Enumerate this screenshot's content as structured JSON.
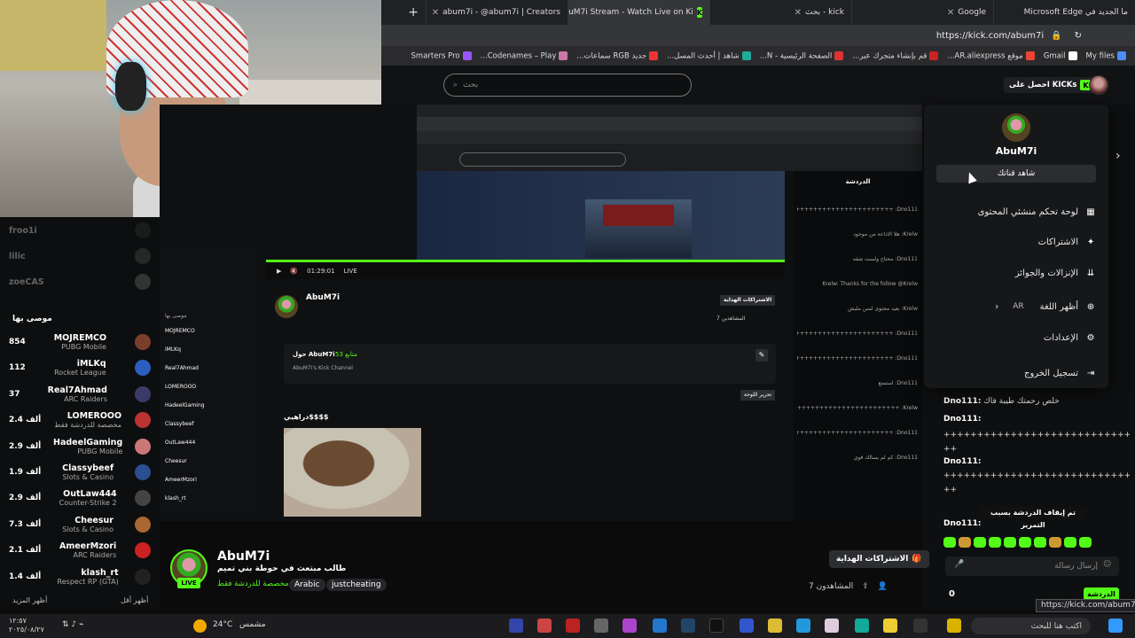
{
  "browser": {
    "tabs": [
      {
        "label": "ما الجديد في Microsoft Edge",
        "active": false
      },
      {
        "label": "Google",
        "active": false
      },
      {
        "label": "kick - بحث",
        "active": false
      },
      {
        "label": "AbuM7i Stream - Watch Live on Ki",
        "active": true
      },
      {
        "label": "abum7i - @abum7i | Creators",
        "active": false
      }
    ],
    "new_tab": "+",
    "url": "https://kick.com/abum7i",
    "bookmarks": [
      "My files",
      "Gmail",
      "موقع AR.aliexpress...",
      "قم بإنشاء متجرك عبر...",
      "الصفحة الرئيسية - N...",
      "شاهد | أحدث المسل...",
      "جديد RGB سماعات...",
      "Codenames – Play...",
      "Smarters Pro"
    ]
  },
  "kick": {
    "search_placeholder": "بحث",
    "get_kicks": "احصل على KICKs"
  },
  "menu": {
    "username": "AbuM7i",
    "channel_button": "شاهد قناتك",
    "items": [
      {
        "label": "لوحة تحكم منشئي المحتوى",
        "icon": "dashboard-icon"
      },
      {
        "label": "الاشتراكات",
        "icon": "sparkle-icon"
      },
      {
        "label": "الإنزالات والجوائز",
        "icon": "drops-icon"
      },
      {
        "label": "أظهر اللغة",
        "icon": "globe-icon",
        "value": "AR"
      },
      {
        "label": "الإعدادات",
        "icon": "gear-icon"
      },
      {
        "label": "تسجيل الخروج",
        "icon": "logout-icon"
      }
    ]
  },
  "sidebar": {
    "dimmed": [
      {
        "name": "froo1i"
      },
      {
        "name": "lilic"
      },
      {
        "name": "zoeCAS"
      }
    ],
    "section_title": "موصى بها",
    "recommended": [
      {
        "name": "MOJREMCO",
        "category": "PUBG Mobile",
        "count": "854",
        "color": "#7a3f2a"
      },
      {
        "name": "iMLKq",
        "category": "Rocket League",
        "count": "112",
        "color": "#2a5fbf"
      },
      {
        "name": "Real7Ahmad",
        "category": "ARC Raiders",
        "count": "37",
        "color": "#3a3a6a"
      },
      {
        "name": "LOMEROOO",
        "category": "مخصصة للدردشة فقط",
        "count": "2.4 ألف",
        "color": "#b33"
      },
      {
        "name": "HadeelGaming",
        "category": "PUBG Mobile",
        "count": "2.9 ألف",
        "color": "#c77"
      },
      {
        "name": "Classybeef",
        "category": "Slots & Casino",
        "count": "1.9 ألف",
        "color": "#2a4e8f"
      },
      {
        "name": "OutLaw444",
        "category": "Counter-Strike 2",
        "count": "2.9 ألف",
        "color": "#444"
      },
      {
        "name": "Cheesur",
        "category": "Slots & Casino",
        "count": "7.3 ألف",
        "color": "#a63"
      },
      {
        "name": "AmeerMzori",
        "category": "ARC Raiders",
        "count": "2.1 ألف",
        "color": "#c22"
      },
      {
        "name": "klash_rt",
        "category": "Respect RP (GTA)",
        "count": "1.4 ألف",
        "color": "#222"
      }
    ],
    "show_more": "أظهر المزيد",
    "show_less": "أظهر أقل"
  },
  "nested": {
    "time": "01:29:01",
    "live": "LIVE",
    "streamer": "AbuM7i",
    "about": "حول AbuM7i",
    "followers": "متابع 53",
    "channel_desc": "AbuM7i's Kick Channel",
    "meme_caption": "دراهيي$$$$",
    "edit_panel": "تحرير اللوحة",
    "subs_gift": "الاشتراكات الهداية",
    "viewers": "المشاهدين 7",
    "chat_title": "الدردشة",
    "chat_lines": [
      "Dno111: ++++++++++++++++++++++++",
      "Krelw: هلا الاذاعة من موجود",
      "Dno111: محتاج ولست شقه",
      "Krelw: Thanks for the follow @Krelw",
      "Krelw: بعيد محتوى لسن مليش",
      "Dno111: ++++++++++++++++++++++++",
      "Dno111: ++++++++++++++++++++++++",
      "Dno111: استمتع",
      "Krelw: ++++++++++++++++++++++++",
      "Dno111: ++++++++++++++++++++++++",
      "Dno111: كم لم يسالك قوي"
    ]
  },
  "chat": {
    "lines": [
      {
        "user": "Dno111:",
        "text": "خلص رحمتك طيبة فاك"
      },
      {
        "user": "Dno111:",
        "text": ""
      },
      {
        "user": "",
        "text": "++++++++++++++++++++++++++++"
      },
      {
        "user": "",
        "text": "++"
      },
      {
        "user": "Dno111:",
        "text": ""
      },
      {
        "user": "",
        "text": "++++++++++++++++++++++++++++"
      },
      {
        "user": "",
        "text": "++"
      },
      {
        "user": "Dno111:",
        "text": ""
      }
    ],
    "paused": "تم إيقاف الدردشة بسبب التمرير",
    "input_placeholder": "إرسال رسالة",
    "count": "0",
    "send": "الدردشة",
    "tooltip_url": "https://kick.com/abum7i"
  },
  "stream": {
    "name": "AbuM7i",
    "title": "طالب مبتعث في حوطة بني تميم",
    "category": "مخصصة للدردشة فقط",
    "tags": [
      "Arabic",
      "justcheating"
    ],
    "live": "LIVE",
    "subscribe": "الاشتراكات الهداية",
    "viewers": "المشاهدون 7"
  },
  "taskbar": {
    "search": "اكتب هنا للبحث",
    "weather_temp": "24°C",
    "weather_text": "مشمس",
    "time": "١٢:٥٧",
    "date": "٢٠٢٥/٠٨/٢٧"
  },
  "colors": {
    "accent": "#53fc18",
    "bg": "#0e0f10"
  }
}
